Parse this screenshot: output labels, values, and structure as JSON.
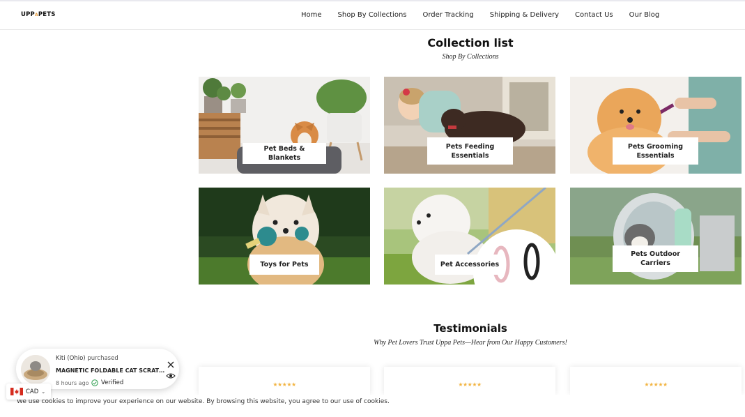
{
  "brand": {
    "logo_left": "UPP",
    "logo_mid": "A",
    "logo_right": "PETS"
  },
  "nav": {
    "items": [
      "Home",
      "Shop By Collections",
      "Order Tracking",
      "Shipping & Delivery",
      "Contact Us",
      "Our Blog"
    ]
  },
  "collections": {
    "title": "Collection list",
    "subtitle": "Shop By Collections",
    "cards": [
      {
        "label": "Pet Beds & Blankets"
      },
      {
        "label": "Pets Feeding Essentials"
      },
      {
        "label": "Pets Grooming Essentials"
      },
      {
        "label": "Toys for Pets"
      },
      {
        "label": "Pet Accessories"
      },
      {
        "label": "Pets Outdoor Carriers"
      }
    ]
  },
  "testimonials": {
    "title": "Testimonials",
    "subtitle": "Why Pet Lovers Trust Uppa Pets—Hear from Our Happy Customers!",
    "cards": [
      {
        "stars": "★★★★★"
      },
      {
        "stars": "★★★★★"
      },
      {
        "stars": "★★★★★"
      }
    ]
  },
  "purchase_popup": {
    "buyer": "Kiti (Ohio)",
    "action": "purchased",
    "product": "MAGNETIC FOLDABLE CAT SCRATCHER",
    "time_ago": "8 hours ago",
    "verified": "Verified",
    "icons": [
      "close-icon",
      "eye-icon",
      "check-circle-icon"
    ]
  },
  "currency": {
    "code": "CAD",
    "flag": "canada-flag-icon"
  },
  "cookie_notice": {
    "text": "We use cookies to improve your experience on our website. By browsing this website, you agree to our use of cookies."
  },
  "colors": {
    "accent_stars": "#f2b441",
    "verified_green": "#2e9e4f",
    "logo_accent": "#e79c3c"
  }
}
